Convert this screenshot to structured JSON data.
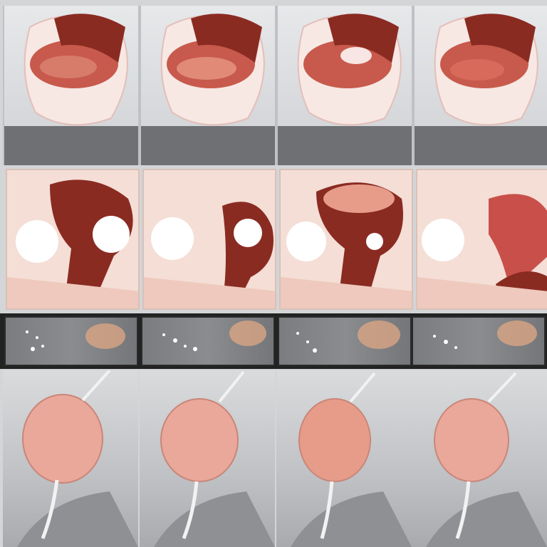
{
  "panel_labels": [
    {
      "top": "",
      "bottom": ""
    },
    {
      "top": "",
      "bottom": ""
    },
    {
      "top": "",
      "bottom": ""
    },
    {
      "top": "",
      "bottom": ""
    }
  ],
  "bottom_tags": [
    "",
    "",
    "",
    ""
  ],
  "middle_glyphs": [
    "",
    "",
    "",
    ""
  ],
  "colors": {
    "flesh": "#e9a89a",
    "dark_red": "#8a2b22",
    "pale": "#f7e8e4",
    "label_band": "#6e7073"
  }
}
